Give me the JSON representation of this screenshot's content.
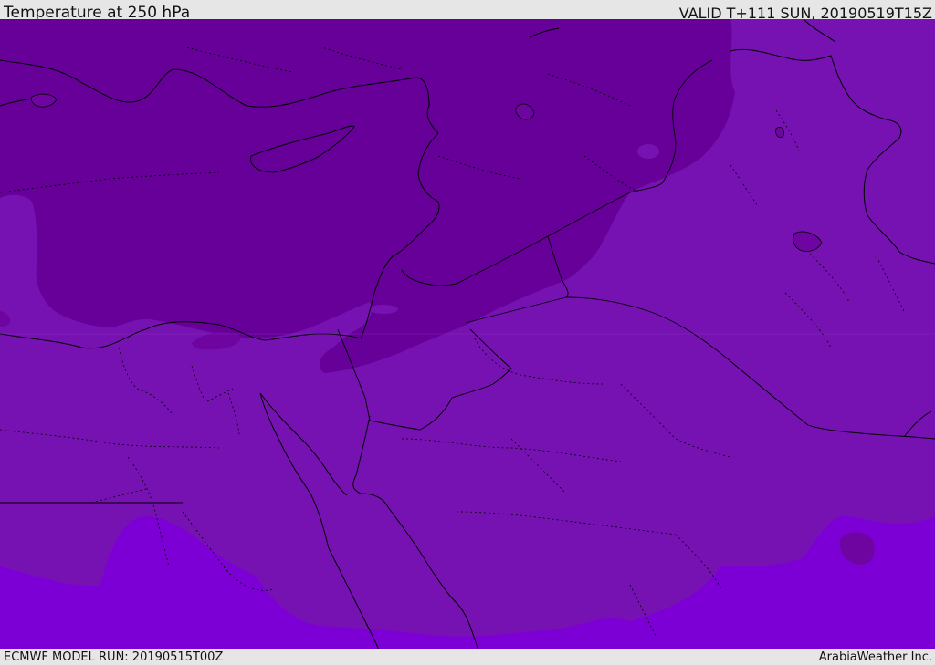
{
  "header": {
    "title": "Temperature at 250 hPa",
    "valid_time": "VALID T+111 SUN, 20190519T15Z"
  },
  "footer": {
    "model_run": "ECMWF MODEL RUN: 20190515T00Z",
    "credit": "ArabiaWeather Inc."
  },
  "map": {
    "colors": {
      "coldest": "#660099",
      "cold": "#6e05a0",
      "mid": "#7712b2",
      "warm": "#7c00d6",
      "border": "#000000"
    }
  }
}
